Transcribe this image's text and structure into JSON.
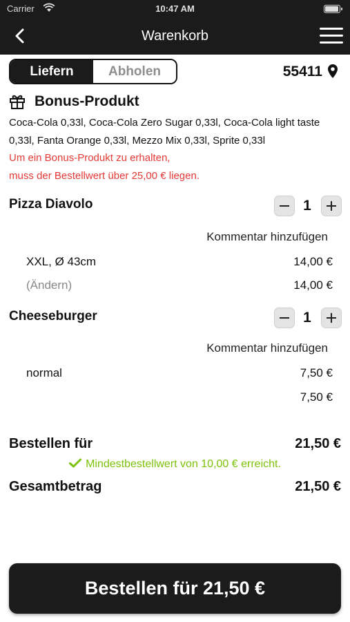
{
  "status_bar": {
    "carrier": "Carrier",
    "time": "10:47 AM"
  },
  "header": {
    "title": "Warenkorb"
  },
  "delivery_toggle": {
    "options": [
      "Liefern",
      "Abholen"
    ],
    "selected": "Liefern"
  },
  "location": {
    "postal_code": "55411"
  },
  "bonus": {
    "title": "Bonus-Produkt",
    "products_line1": "Coca-Cola 0,33l, Coca-Cola Zero Sugar 0,33l, Coca-Cola light taste",
    "products_line2": "0,33l, Fanta Orange 0,33l, Mezzo Mix 0,33l, Sprite 0,33l",
    "hint_line1": "Um ein Bonus-Produkt zu erhalten,",
    "hint_line2": "muss der Bestellwert über 25,00 € liegen."
  },
  "cart": {
    "items": [
      {
        "name": "Pizza Diavolo",
        "quantity": "1",
        "comment_label": "Kommentar hinzufügen",
        "option": "XXL, Ø 43cm",
        "option_price": "14,00 €",
        "change_label": "(Ändern)",
        "total": "14,00 €"
      },
      {
        "name": "Cheeseburger",
        "quantity": "1",
        "comment_label": "Kommentar hinzufügen",
        "option": "normal",
        "option_price": "7,50 €",
        "total": "7,50 €"
      }
    ]
  },
  "summary": {
    "order_label": "Bestellen für",
    "order_value": "21,50 €",
    "minimum_notice": "Mindestbestellwert von 10,00 € erreicht.",
    "total_label": "Gesamtbetrag",
    "total_value": "21,50 €"
  },
  "checkout": {
    "button_label": "Bestellen für 21,50 €"
  },
  "colors": {
    "bar": "#1b1b1b",
    "warning": "#e53935",
    "success": "#7cc10a"
  },
  "icons": [
    "wifi-icon",
    "battery-icon",
    "back-arrow-icon",
    "hamburger-menu-icon",
    "location-pin-icon",
    "gift-icon",
    "minus-icon",
    "plus-icon",
    "check-icon"
  ]
}
